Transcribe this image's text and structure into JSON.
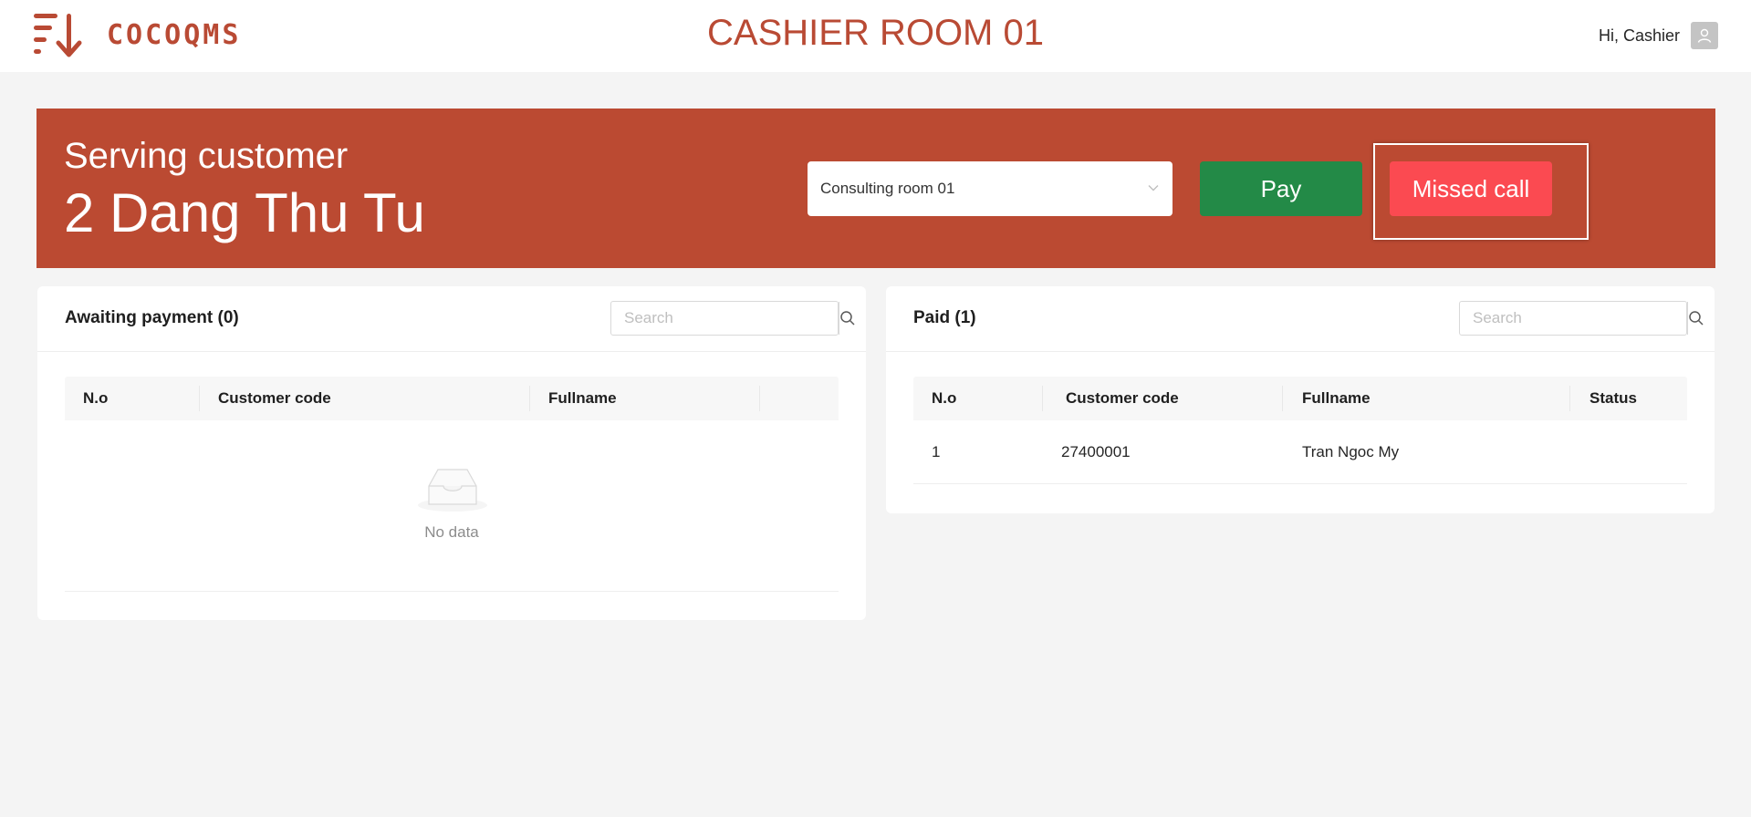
{
  "header": {
    "logo_text": "COCOQMS",
    "title": "CASHIER ROOM 01",
    "greeting": "Hi, Cashier"
  },
  "serving": {
    "label": "Serving customer",
    "customer": "2 Dang Thu Tu",
    "room_selected": "Consulting room 01",
    "pay_label": "Pay",
    "missed_label": "Missed call"
  },
  "awaiting": {
    "title": "Awaiting payment (0)",
    "search_placeholder": "Search",
    "columns": [
      "N.o",
      "Customer code",
      "Fullname"
    ],
    "empty_text": "No data"
  },
  "paid": {
    "title": "Paid (1)",
    "search_placeholder": "Search",
    "columns": [
      "N.o",
      "Customer code",
      "Fullname",
      "Status"
    ],
    "rows": [
      {
        "no": "1",
        "code": "27400001",
        "name": "Tran Ngoc My",
        "status": ""
      }
    ]
  },
  "colors": {
    "brand": "#bb4a32",
    "pay": "#238a47",
    "missed": "#fb4a51"
  }
}
